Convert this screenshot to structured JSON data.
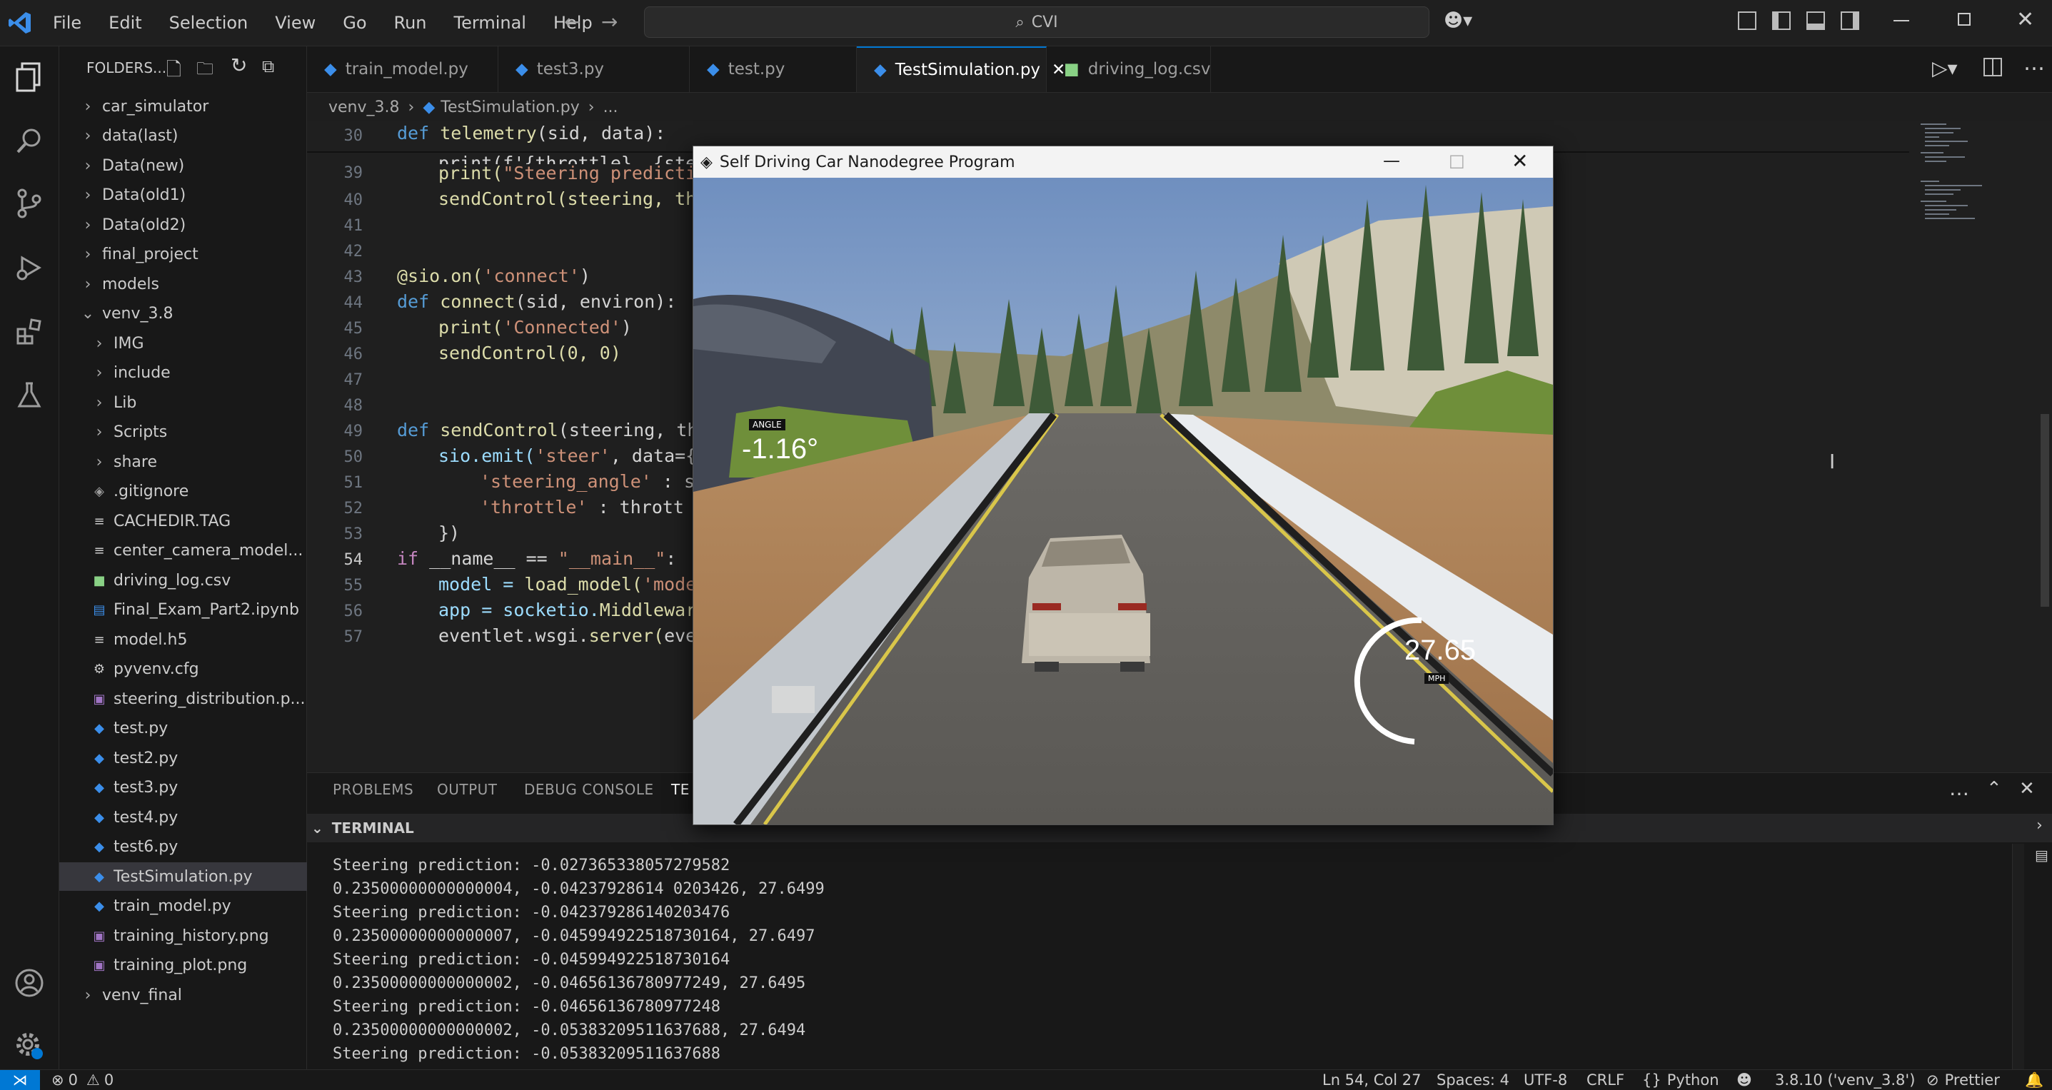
{
  "menu": [
    "File",
    "Edit",
    "Selection",
    "View",
    "Go",
    "Run",
    "Terminal",
    "Help"
  ],
  "search_text": "CVI",
  "explorer_title": "FOLDERS...",
  "tree": [
    {
      "label": "car_simulator",
      "type": "folder",
      "indent": 0
    },
    {
      "label": "data(last)",
      "type": "folder",
      "indent": 0
    },
    {
      "label": "Data(new)",
      "type": "folder",
      "indent": 0
    },
    {
      "label": "Data(old1)",
      "type": "folder",
      "indent": 0
    },
    {
      "label": "Data(old2)",
      "type": "folder",
      "indent": 0
    },
    {
      "label": "final_project",
      "type": "folder",
      "indent": 0
    },
    {
      "label": "models",
      "type": "folder",
      "indent": 0
    },
    {
      "label": "venv_3.8",
      "type": "folder-open",
      "indent": 0
    },
    {
      "label": "IMG",
      "type": "folder",
      "indent": 1
    },
    {
      "label": "include",
      "type": "folder",
      "indent": 1
    },
    {
      "label": "Lib",
      "type": "folder",
      "indent": 1
    },
    {
      "label": "Scripts",
      "type": "folder",
      "indent": 1
    },
    {
      "label": "share",
      "type": "folder",
      "indent": 1
    },
    {
      "label": ".gitignore",
      "type": "file-git",
      "indent": 1
    },
    {
      "label": "CACHEDIR.TAG",
      "type": "file-txt",
      "indent": 1
    },
    {
      "label": "center_camera_model...",
      "type": "file-txt",
      "indent": 1
    },
    {
      "label": "driving_log.csv",
      "type": "file-csv",
      "indent": 1
    },
    {
      "label": "Final_Exam_Part2.ipynb",
      "type": "file-nb",
      "indent": 1
    },
    {
      "label": "model.h5",
      "type": "file-txt",
      "indent": 1
    },
    {
      "label": "pyvenv.cfg",
      "type": "file-cfg",
      "indent": 1
    },
    {
      "label": "steering_distribution.p...",
      "type": "file-img",
      "indent": 1
    },
    {
      "label": "test.py",
      "type": "file-py",
      "indent": 1
    },
    {
      "label": "test2.py",
      "type": "file-py",
      "indent": 1
    },
    {
      "label": "test3.py",
      "type": "file-py",
      "indent": 1
    },
    {
      "label": "test4.py",
      "type": "file-py",
      "indent": 1
    },
    {
      "label": "test6.py",
      "type": "file-py",
      "indent": 1
    },
    {
      "label": "TestSimulation.py",
      "type": "file-py",
      "indent": 1,
      "selected": true
    },
    {
      "label": "train_model.py",
      "type": "file-py",
      "indent": 1
    },
    {
      "label": "training_history.png",
      "type": "file-img",
      "indent": 1
    },
    {
      "label": "training_plot.png",
      "type": "file-img",
      "indent": 1
    },
    {
      "label": "venv_final",
      "type": "folder",
      "indent": 0
    }
  ],
  "tabs": [
    {
      "label": "train_model.py",
      "active": false,
      "icon": "python"
    },
    {
      "label": "test3.py",
      "active": false,
      "icon": "python"
    },
    {
      "label": "test.py",
      "active": false,
      "icon": "python"
    },
    {
      "label": "TestSimulation.py",
      "active": true,
      "icon": "python"
    },
    {
      "label": "driving_log.csv",
      "active": false,
      "icon": "csv"
    }
  ],
  "breadcrumb": [
    "venv_3.8",
    "TestSimulation.py",
    "..."
  ],
  "line_numbers": [
    "30",
    "39",
    "40",
    "41",
    "42",
    "43",
    "44",
    "45",
    "46",
    "47",
    "48",
    "49",
    "50",
    "51",
    "52",
    "53",
    "54",
    "55",
    "56",
    "57"
  ],
  "code_text": {
    "l30_def": "def",
    "l30_fn": "telemetry",
    "l30_args": "(sid, data):",
    "l38": "print(f'{throttle}, {ste",
    "l39_a": "print(",
    "l39_b": "\"Steering predictio",
    "l40": "sendControl(steering, thr",
    "l43_a": "@sio.on(",
    "l43_b": "'connect'",
    "l43_c": ")",
    "l44_def": "def",
    "l44_fn": "connect",
    "l44_args": "(sid, environ):",
    "l45_a": "print(",
    "l45_b": "'Connected'",
    "l45_c": ")",
    "l46": "sendControl(0, 0)",
    "l49_def": "def",
    "l49_fn": "sendControl",
    "l49_args": "(steering, thr",
    "l50_a": "sio.emit(",
    "l50_b": "'steer'",
    "l50_c": ", data={",
    "l51_a": "'steering_angle'",
    "l51_b": " : st",
    "l52_a": "'throttle'",
    "l52_b": " : thrott",
    "l53": "})",
    "l54_if": "if",
    "l54_a": " __name__ == ",
    "l54_b": "\"__main__\"",
    "l54_c": ":",
    "l55_a": "model = ",
    "l55_b": "load_model(",
    "l55_c": "'model",
    "l56_a": "app = socketio.",
    "l56_b": "Middleware",
    "l57_a": "eventlet.wsgi.",
    "l57_b": "server(",
    "l57_c": "even"
  },
  "panel_tabs": [
    "PROBLEMS",
    "OUTPUT",
    "DEBUG CONSOLE",
    "TE"
  ],
  "terminal_header": "TERMINAL",
  "terminal_lines": [
    "Steering prediction: -0.027365338057279582",
    "0.23500000000000004, -0.04237928614 0203426, 27.6499",
    "Steering prediction: -0.042379286140203476",
    "0.23500000000000007, -0.045994922518730164, 27.6497",
    "Steering prediction: -0.045994922518730164",
    "0.23500000000000002, -0.04656136780977249, 27.6495",
    "Steering prediction: -0.04656136780977248",
    "0.23500000000000002, -0.05383209511637688, 27.6494",
    "Steering prediction: -0.05383209511637688"
  ],
  "simulator": {
    "title": "Self Driving Car Nanodegree Program",
    "angle_label": "ANGLE",
    "angle_value": "-1.16°",
    "speed_value": "27.65",
    "speed_label": "MPH"
  },
  "status": {
    "errors": "0",
    "warnings": "0",
    "position": "Ln 54, Col 27",
    "spaces": "Spaces: 4",
    "encoding": "UTF-8",
    "eol": "CRLF",
    "language": "Python",
    "interpreter": "3.8.10 ('venv_3.8')",
    "formatter": "Prettier"
  },
  "colors": {
    "accent": "#0078d4",
    "python_icon": "#3b8eea",
    "csv_icon": "#89d185",
    "img_icon": "#a074c4"
  }
}
